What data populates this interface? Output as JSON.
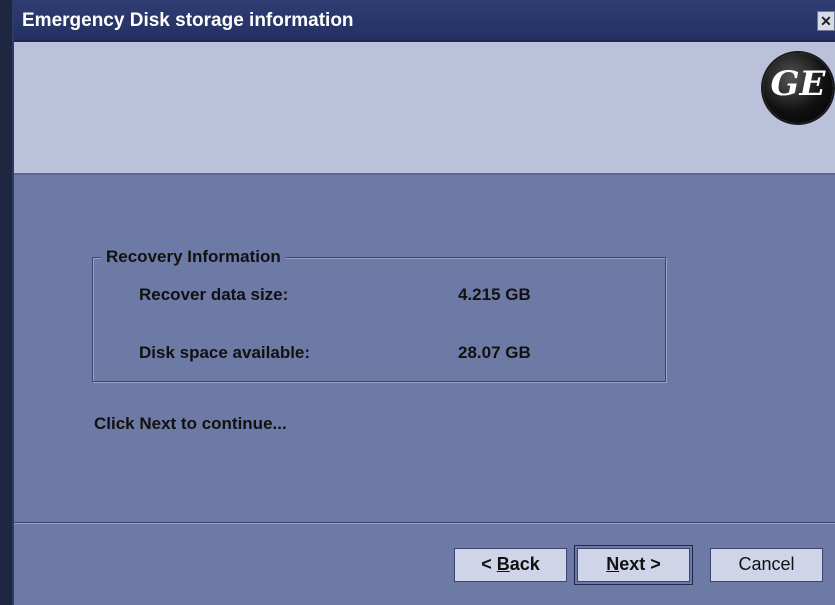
{
  "window": {
    "title": "Emergency Disk storage information",
    "close_glyph": "✕"
  },
  "logo": {
    "text": "GE"
  },
  "recovery": {
    "group_label": "Recovery Information",
    "rows": [
      {
        "label": "Recover data size:",
        "value": "4.215 GB"
      },
      {
        "label": "Disk space available:",
        "value": "28.07 GB"
      }
    ]
  },
  "instructions": {
    "continue": "Click Next to continue..."
  },
  "buttons": {
    "back": {
      "prefix": "< ",
      "mnemonic": "B",
      "rest": "ack"
    },
    "next": {
      "mnemonic": "N",
      "rest": "ext >"
    },
    "cancel": "Cancel"
  }
}
